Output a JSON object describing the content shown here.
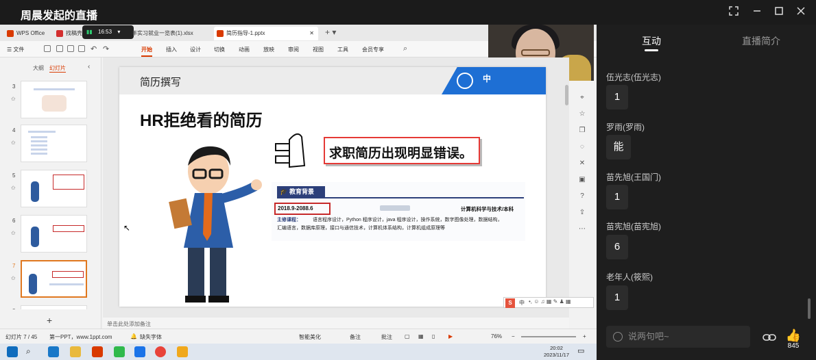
{
  "window": {
    "title": "周晨发起的直播",
    "controls": [
      "fullscreen-icon",
      "minimize-icon",
      "maximize-icon",
      "close-icon"
    ]
  },
  "wps": {
    "tabs": [
      {
        "label": "WPS Office",
        "color": "#d93a00"
      },
      {
        "label": "找稿壳",
        "color": "#d32f2f"
      },
      {
        "label": "年实习就业一览表(1).xlsx",
        "color": "#1e8e3e"
      },
      {
        "label": "简历指导-1.pptx",
        "color": "#d93a00"
      }
    ],
    "signal_time": "16:53",
    "menu_file": "文件",
    "menus": [
      "开始",
      "插入",
      "设计",
      "切换",
      "动画",
      "放映",
      "审阅",
      "视图",
      "工具",
      "会员专享"
    ],
    "active_menu": "开始",
    "panel_tabs": [
      "大纲",
      "幻灯片"
    ],
    "thumb_numbers": [
      "3",
      "4",
      "5",
      "6",
      "7",
      "8"
    ],
    "add_slide": "+",
    "notes_placeholder": "单击此处添加备注",
    "status": {
      "slide_count": "幻灯片 7 / 45",
      "theme": "第一PPT，www.1ppt.com",
      "missing_font": "缺失字体",
      "smart_beautify": "智能美化",
      "notes": "备注",
      "comments": "批注",
      "zoom": "76%"
    },
    "clock": {
      "time": "20:02",
      "date": "2023/11/17"
    }
  },
  "slide": {
    "header": "简历撰写",
    "logo": "中",
    "title": "HR拒绝看的简历",
    "callout": "求职简历出现明显错误。",
    "edu_section": "教育背景",
    "edu_date": "2018.9-2088.6",
    "edu_major": "计算机科学与技术/本科",
    "edu_course_label": "主修课程：",
    "edu_courses_1": "语言程序设计，Python 程序设计，java 程序设计，操作系统，数字图像处理，数据结构，",
    "edu_courses_2": "汇编语言，数据库原理，接口与通信技术，计算机体系结构，计算机组成原理等"
  },
  "ime": {
    "label": "中"
  },
  "side": {
    "tabs": [
      "互动",
      "直播简介"
    ],
    "messages": [
      {
        "name": "伍光志(伍光志)",
        "text": "1"
      },
      {
        "name": "罗雨(罗雨)",
        "text": "能"
      },
      {
        "name": "苗先旭(王国门)",
        "text": "1"
      },
      {
        "name": "苗宪旭(苗宪旭)",
        "text": "6"
      },
      {
        "name": "老年人(筱熙)",
        "text": "1"
      }
    ],
    "input_placeholder": "说两句吧~",
    "like_count": "845"
  }
}
